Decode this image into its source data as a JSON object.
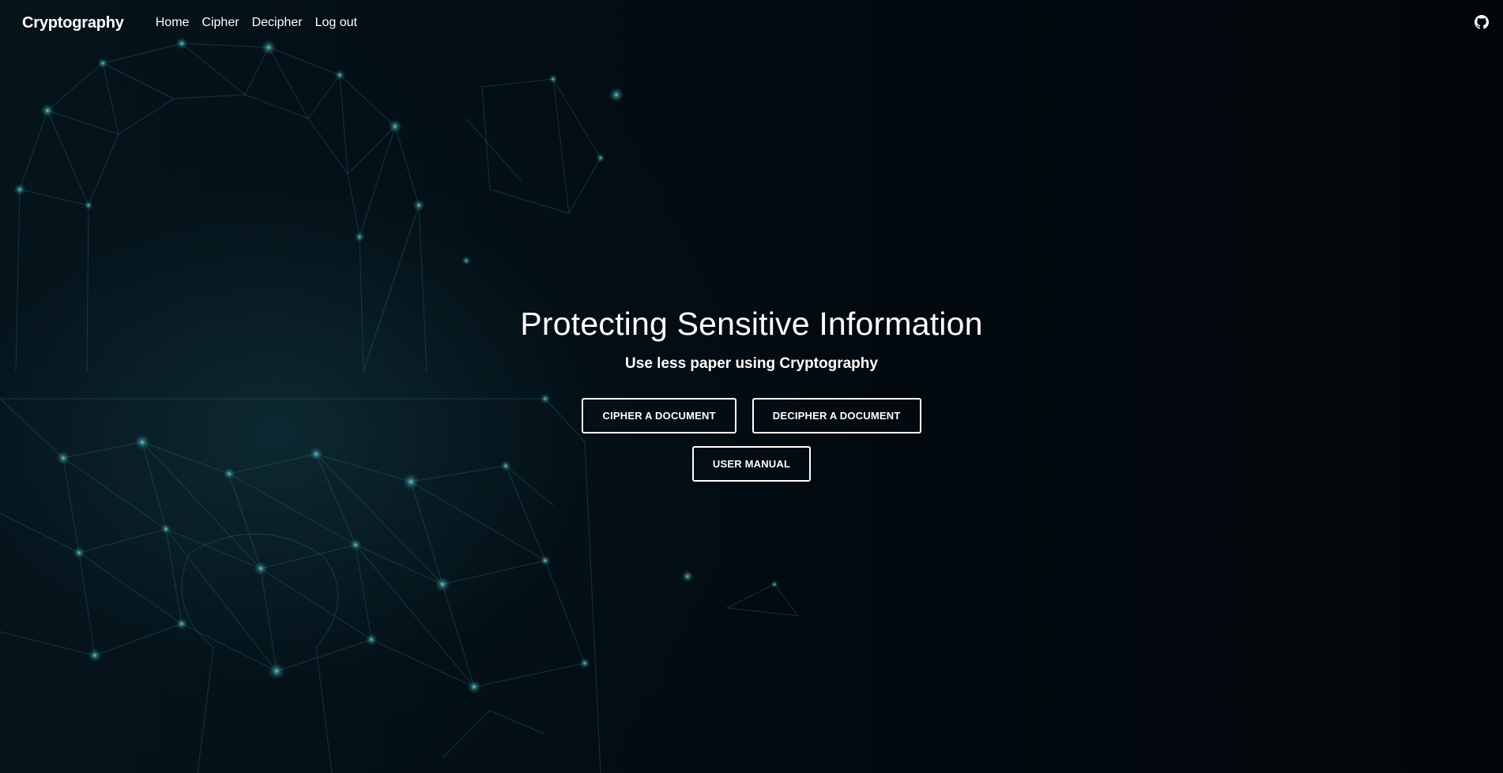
{
  "navbar": {
    "brand": "Cryptography",
    "links": [
      {
        "label": "Home"
      },
      {
        "label": "Cipher"
      },
      {
        "label": "Decipher"
      },
      {
        "label": "Log out"
      }
    ],
    "github_icon": "github-icon"
  },
  "hero": {
    "title": "Protecting Sensitive Information",
    "subtitle": "Use less paper using Cryptography",
    "buttons": {
      "cipher": "CIPHER A DOCUMENT",
      "decipher": "DECIPHER A DOCUMENT",
      "manual": "USER MANUAL"
    }
  },
  "colors": {
    "background": "#02080d",
    "network": "#2f7f86",
    "text": "#ffffff"
  }
}
